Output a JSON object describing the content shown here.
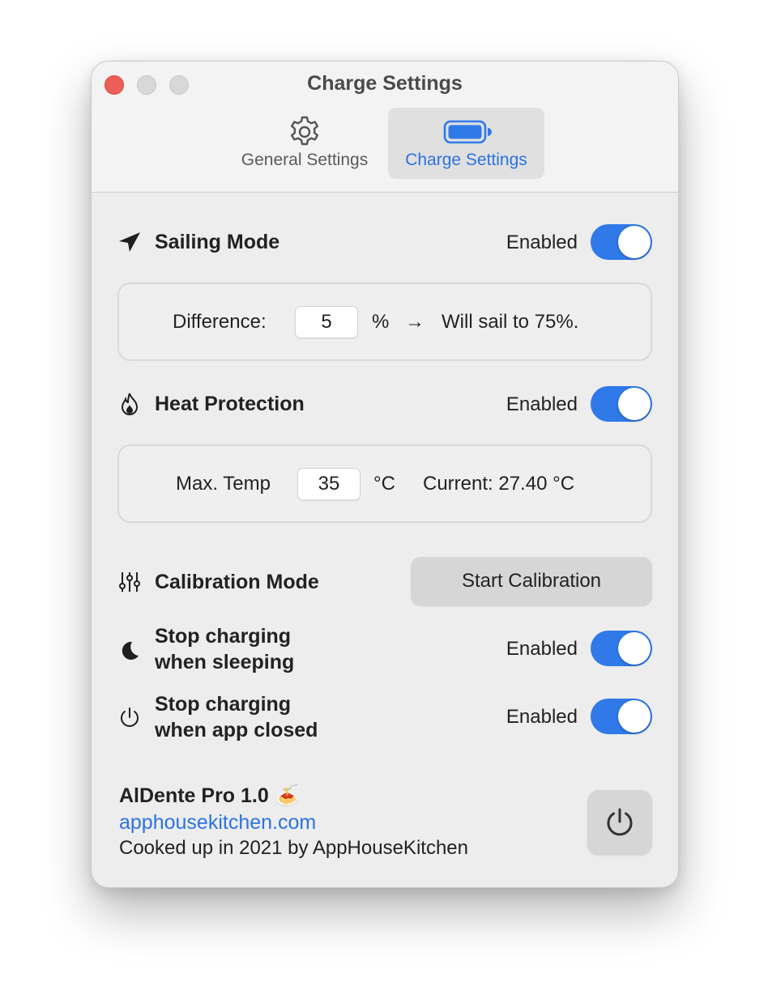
{
  "window": {
    "title": "Charge Settings"
  },
  "tabs": [
    {
      "label": "General Settings",
      "icon": "gear-icon",
      "selected": false
    },
    {
      "label": "Charge Settings",
      "icon": "battery-icon",
      "selected": true
    }
  ],
  "sailing_mode": {
    "title": "Sailing Mode",
    "icon": "paper-plane-icon",
    "status_label": "Enabled",
    "enabled": true,
    "difference_label": "Difference:",
    "difference_value": "5",
    "unit": "%",
    "arrow": "→",
    "result_text": "Will sail to 75%."
  },
  "heat_protection": {
    "title": "Heat Protection",
    "icon": "flame-icon",
    "status_label": "Enabled",
    "enabled": true,
    "max_temp_label": "Max. Temp",
    "max_temp_value": "35",
    "unit": "°C",
    "current_text": "Current: 27.40 °C"
  },
  "calibration": {
    "title": "Calibration Mode",
    "icon": "sliders-icon",
    "button_label": "Start Calibration"
  },
  "stop_sleeping": {
    "title_line1": "Stop charging",
    "title_line2": "when sleeping",
    "icon": "moon-icon",
    "status_label": "Enabled",
    "enabled": true
  },
  "stop_app_closed": {
    "title_line1": "Stop charging",
    "title_line2": "when app closed",
    "icon": "power-icon",
    "status_label": "Enabled",
    "enabled": true
  },
  "footer": {
    "app_name": "AlDente Pro 1.0",
    "emoji": "🍝",
    "link": "apphousekitchen.com",
    "credit": "Cooked up in 2021 by AppHouseKitchen"
  },
  "colors": {
    "accent": "#2f79e8",
    "link": "#2b73e0",
    "close": "#ec5f57"
  }
}
